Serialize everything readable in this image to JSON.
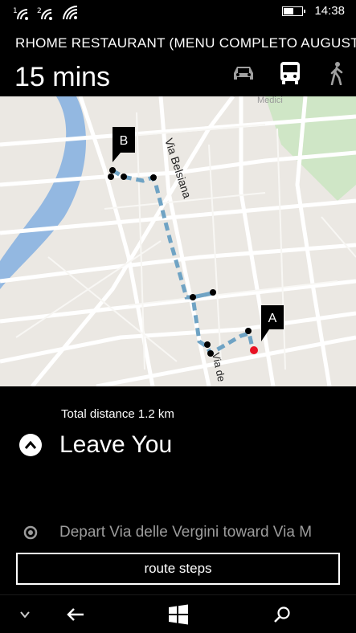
{
  "status": {
    "time": "14:38",
    "icons": [
      "sim1-signal-icon",
      "sim2-signal-icon",
      "wifi-icon",
      "battery-icon"
    ],
    "battery_fill": 0.5
  },
  "header": {
    "destination": "RHOME RESTAURANT (MENU COMPLETO AUGUSTO",
    "duration": "15 mins",
    "modes": [
      {
        "name": "car-mode-icon",
        "selected": false
      },
      {
        "name": "bus-mode-icon",
        "selected": true
      },
      {
        "name": "walk-mode-icon",
        "selected": false
      }
    ]
  },
  "map": {
    "labels": {
      "via_belsiana": "Via Belsiana",
      "via_de": "Via de",
      "medici": "Medici"
    },
    "marker_a": "A",
    "marker_b": "B",
    "colors": {
      "land": "#ebe8e3",
      "road": "#ffffff",
      "river": "#93b8e1",
      "park": "#cfe6c6",
      "route": "#6fa3c4",
      "destination_dot": "#e81123"
    }
  },
  "directions": {
    "total_distance": "Total distance 1.2 km",
    "current_step": "Leave You",
    "next_step": "Depart Via delle Vergini toward Via M",
    "route_steps_label": "route steps"
  },
  "navbar": {
    "items": [
      "chevron-down-icon",
      "back-icon",
      "windows-start-icon",
      "search-icon"
    ]
  }
}
